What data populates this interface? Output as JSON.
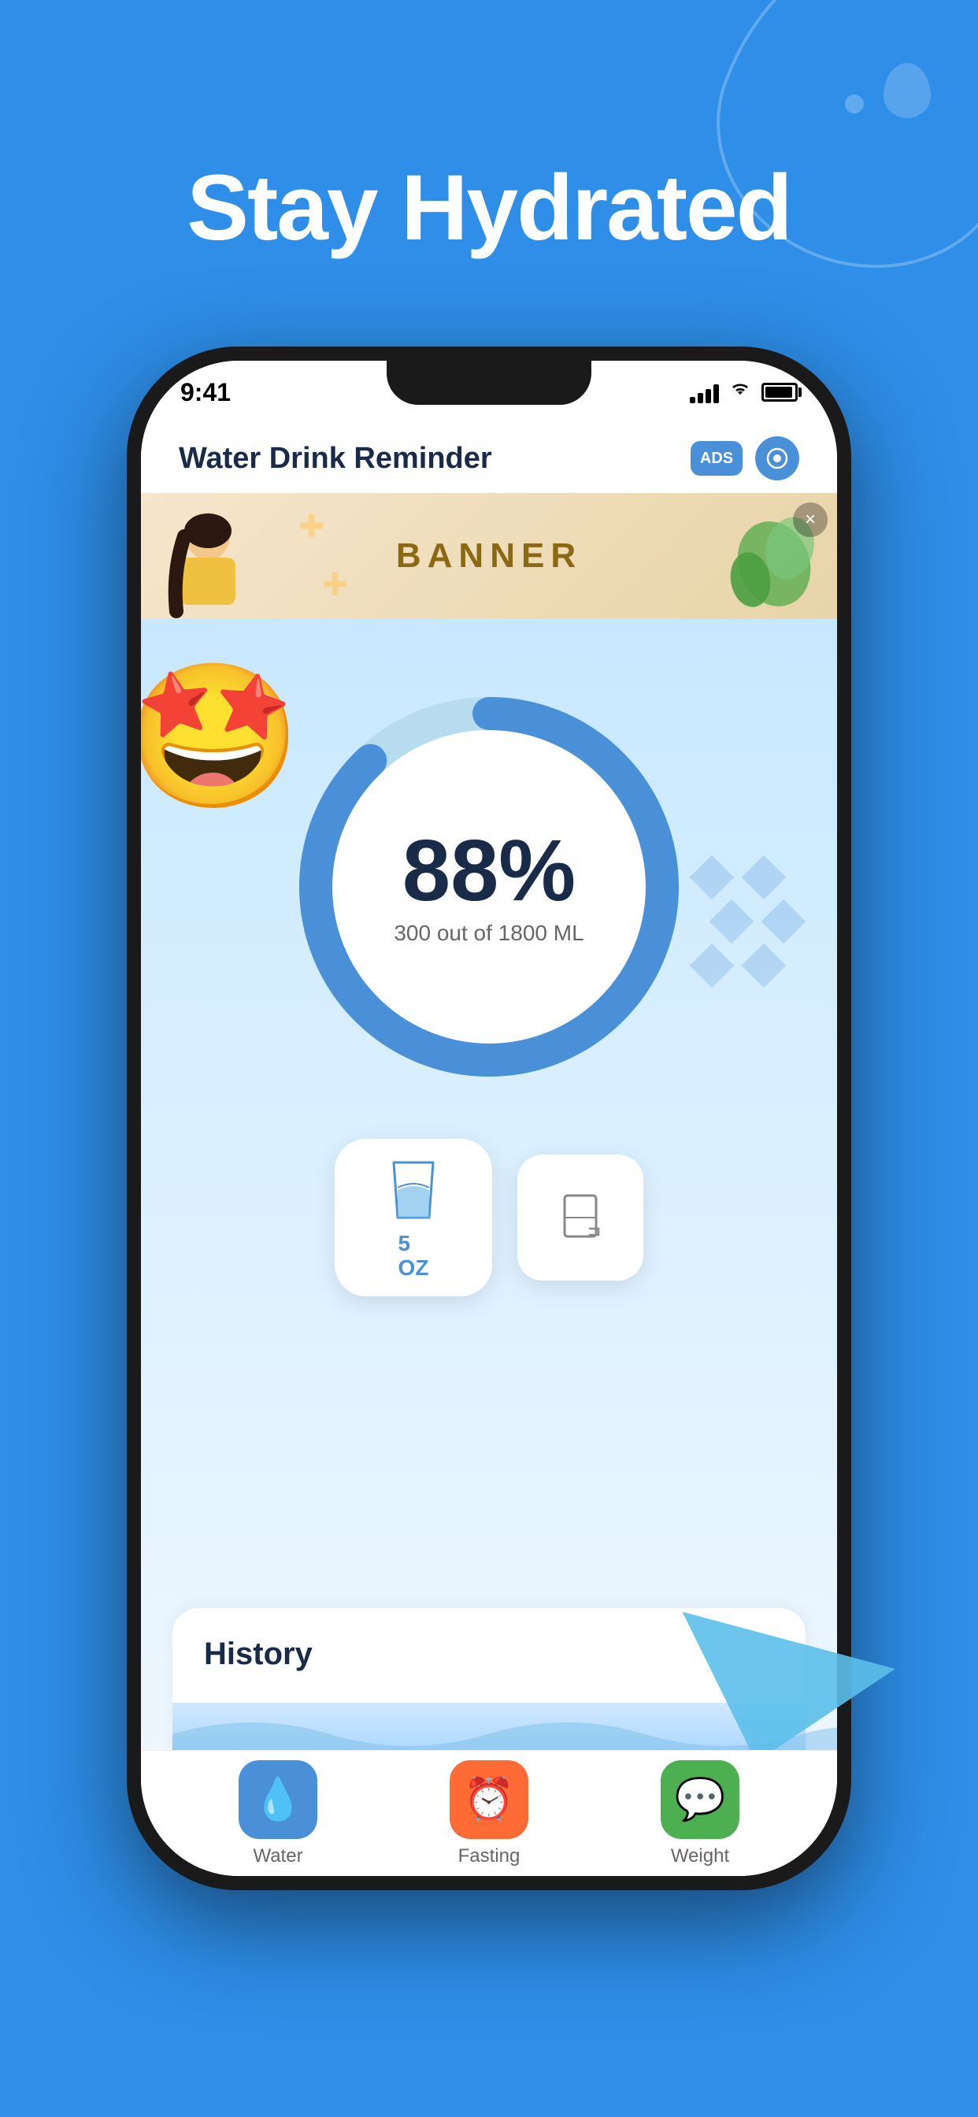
{
  "page": {
    "background_color": "#2E8EE8",
    "title": "Stay Hydrated"
  },
  "status_bar": {
    "time": "9:41",
    "signal": "signal",
    "wifi": "wifi",
    "battery": "battery"
  },
  "app_header": {
    "title": "Water Drink Reminder",
    "ads_label": "ADS",
    "settings_icon": "settings-icon"
  },
  "banner": {
    "text": "BANNER",
    "close_icon": "×"
  },
  "progress": {
    "percent": "88%",
    "subtitle": "300 out of 1800 ML",
    "value": 88,
    "emoji": "🤩"
  },
  "drink_buttons": {
    "primary_label": "5\nOZ",
    "primary_icon": "glass-water-icon",
    "secondary_icon": "custom-glass-icon"
  },
  "history": {
    "title": "History"
  },
  "tabs": [
    {
      "id": "water",
      "label": "Water",
      "icon": "💧",
      "active": true
    },
    {
      "id": "fasting",
      "label": "Fasting",
      "icon": "⏰",
      "active": false
    },
    {
      "id": "weight",
      "label": "Weight",
      "icon": "💬",
      "active": false
    }
  ],
  "decorations": {
    "diamond_count": 6
  }
}
